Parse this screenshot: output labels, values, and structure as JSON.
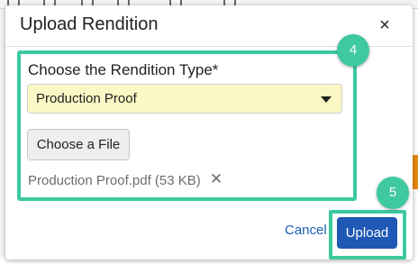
{
  "dialog": {
    "title": "Upload Rendition",
    "close_glyph": "×"
  },
  "form": {
    "label": "Choose the Rendition Type*",
    "select_value": "Production Proof",
    "file_button_label": "Choose a File",
    "file_name": "Production Proof.pdf (53 KB)",
    "remove_glyph": "✕"
  },
  "footer": {
    "cancel_label": "Cancel",
    "upload_label": "Upload"
  },
  "callouts": {
    "step_4": "4",
    "step_5": "5",
    "accent_color": "#3ec9a0"
  },
  "colors": {
    "primary_button": "#1f58b5",
    "select_background": "#fbf8c5",
    "link": "#1a5fb4"
  },
  "icons": {
    "close": "close-icon",
    "caret": "caret-down-icon",
    "remove": "remove-file-icon"
  }
}
